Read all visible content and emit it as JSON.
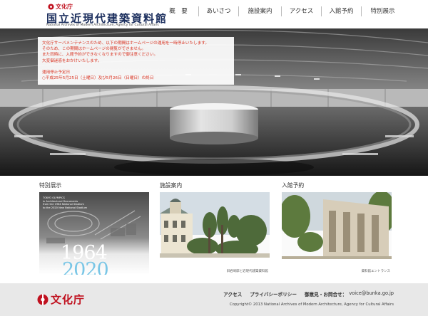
{
  "header": {
    "agency_name": "文化庁",
    "site_title_jp": "国立近現代建築資料館",
    "site_title_en": "National Archives of Modern Architecture, Agency for Cultural Affairs"
  },
  "nav": {
    "items": [
      {
        "label": "概　要"
      },
      {
        "label": "あいさつ"
      },
      {
        "label": "施設案内"
      },
      {
        "label": "アクセス"
      },
      {
        "label": "入館予約"
      },
      {
        "label": "特別展示"
      }
    ]
  },
  "notice": {
    "lines": [
      "文化庁サーバメンテナンスのため、以下の期間はホームページの運用を一時停止いたします。",
      "そのため、この期間はホームページの閲覧ができません。",
      "また同時に、入館予約ができなくなりますので御注意ください。",
      "大変御迷惑をおかけいたします。"
    ],
    "period_label": "運用停止予定日",
    "period_value": "○平成25年5月25日（土曜日）及び5月26日（日曜日）の終日"
  },
  "sections": [
    {
      "title": "特別展示",
      "poster_lines": [
        "TOKYO OLYMPICS",
        "in Architectural Documents",
        "from the 1964 National Stadium",
        "to the 2020 New National Stadium"
      ],
      "year_1": "1964",
      "year_2": "2020"
    },
    {
      "title": "施設案内",
      "caption": "旧岩崎邸と近現代建築資料館"
    },
    {
      "title": "入館予約",
      "caption": "資料館エントランス"
    }
  ],
  "footer": {
    "agency_name": "文化庁",
    "links": [
      "アクセス",
      "プライバシーポリシー",
      "御意見・お問合せ："
    ],
    "email": "voice@bunka.go.jp",
    "copyright": "Copyright© 2013 National Archives of Modern Architecture, Agency for Cultural Affairs"
  },
  "colors": {
    "agency_red": "#c0111f",
    "title_navy": "#1c2f5e",
    "notice_red": "#d9301e",
    "footer_bg": "#e8e8e8"
  }
}
